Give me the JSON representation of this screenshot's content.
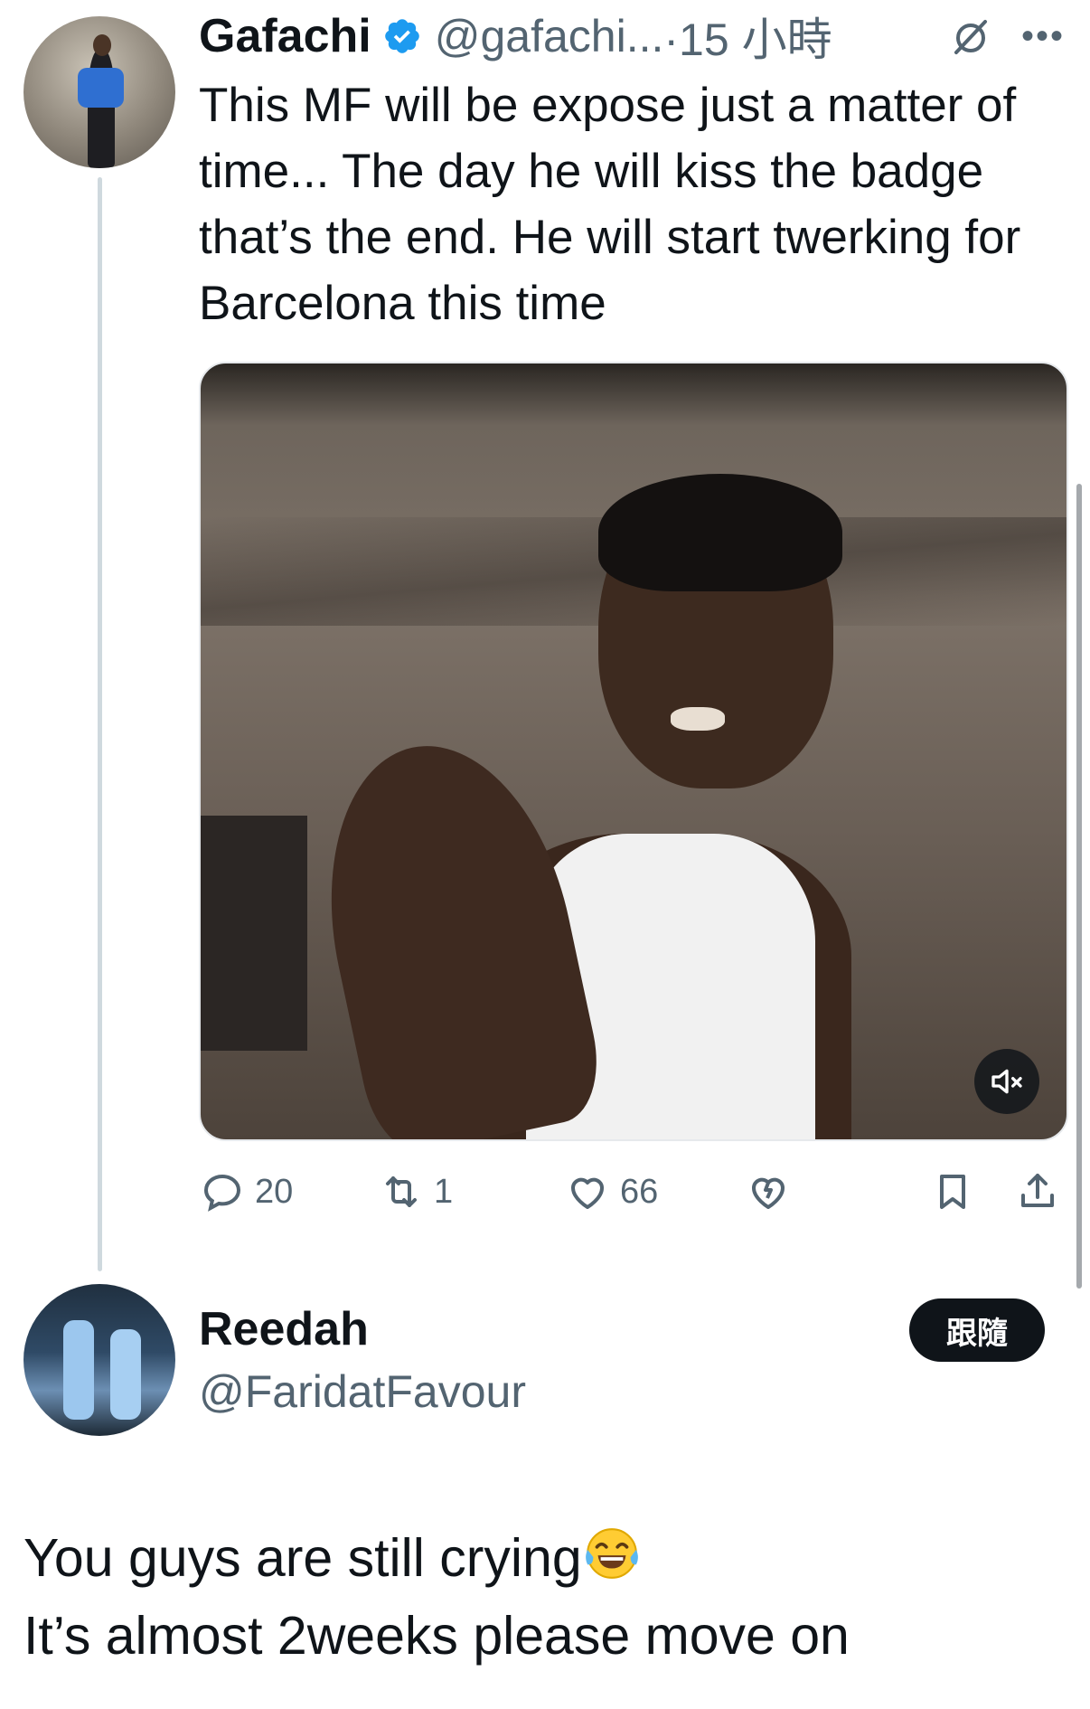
{
  "parent_tweet": {
    "display_name": "Gafachi",
    "handle": "@gafachi...",
    "time": "·15 小時",
    "text": "This MF will be expose just a matter of time... The day he will kiss the badge that’s the end. He will start twerking for Barcelona this time",
    "actions": {
      "replies": "20",
      "retweets": "1",
      "likes": "66"
    }
  },
  "reply_tweet": {
    "display_name": "Reedah",
    "handle": "@FaridatFavour",
    "follow_label": "跟隨",
    "text_line1": "You guys are still crying",
    "text_line2": "It’s almost 2weeks please move on"
  },
  "icons": {
    "verified": "verified-badge-icon",
    "muted": "muted-conversation-icon",
    "more": "more-options-icon",
    "reply": "reply-icon",
    "retweet": "retweet-icon",
    "like": "heart-icon",
    "dislike": "broken-heart-icon",
    "bookmark": "bookmark-icon",
    "share": "share-icon",
    "video_mute": "speaker-muted-icon",
    "emoji": "tears-of-joy-emoji"
  },
  "colors": {
    "text": "#0f1419",
    "secondary": "#536471",
    "verified": "#1d9bf0",
    "thread_line": "#cfd9de",
    "button_bg": "#0f1419"
  }
}
